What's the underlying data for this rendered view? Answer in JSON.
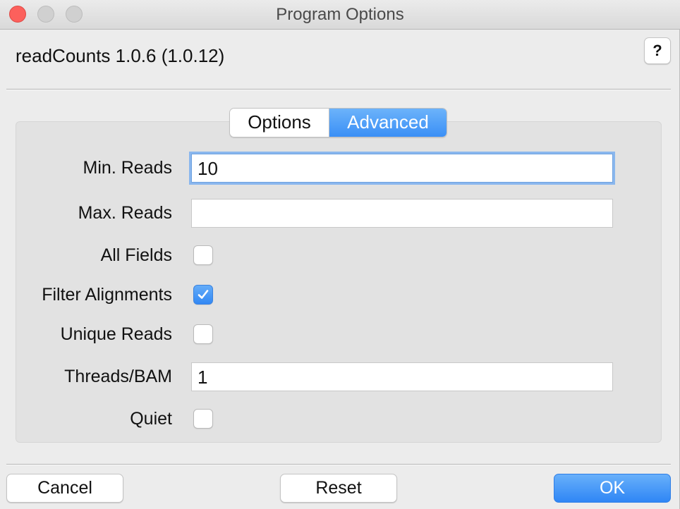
{
  "window": {
    "title": "Program Options"
  },
  "header": {
    "app_title": "readCounts 1.0.6 (1.0.12)",
    "help_label": "?"
  },
  "tabs": [
    {
      "label": "Options",
      "selected": false
    },
    {
      "label": "Advanced",
      "selected": true
    }
  ],
  "form": {
    "min_reads": {
      "label": "Min. Reads",
      "value": "10",
      "focused": true
    },
    "max_reads": {
      "label": "Max. Reads",
      "value": ""
    },
    "all_fields": {
      "label": "All Fields",
      "checked": false
    },
    "filter_alignments": {
      "label": "Filter Alignments",
      "checked": true
    },
    "unique_reads": {
      "label": "Unique Reads",
      "checked": false
    },
    "threads_bam": {
      "label": "Threads/BAM",
      "value": "1"
    },
    "quiet": {
      "label": "Quiet",
      "checked": false
    }
  },
  "footer": {
    "cancel_label": "Cancel",
    "reset_label": "Reset",
    "ok_label": "OK"
  },
  "colors": {
    "accent": "#3a8ff6",
    "close_button": "#fc605c",
    "window_bg": "#ececec",
    "panel_bg": "#e2e2e2"
  }
}
